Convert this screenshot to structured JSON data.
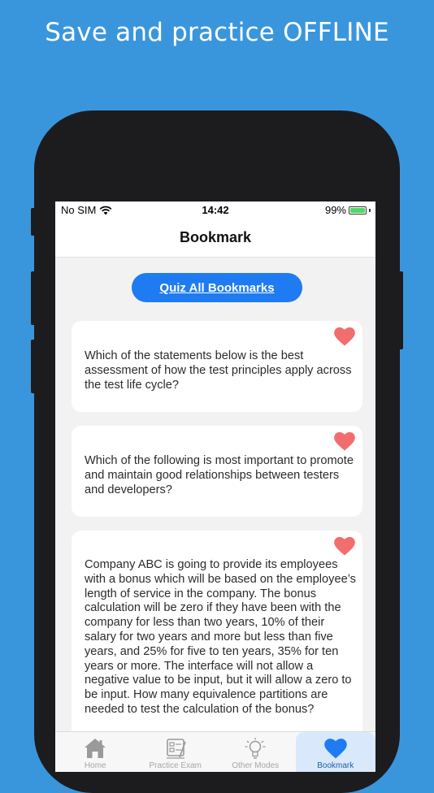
{
  "headline": "Save and practice OFFLINE",
  "status": {
    "carrier": "No SIM",
    "time": "14:42",
    "battery": "99%"
  },
  "nav": {
    "title": "Bookmark"
  },
  "quiz_button": "Quiz All Bookmarks",
  "cards": [
    {
      "text": "Which of the statements below is the best assessment of how the test principles apply across the test life cycle?"
    },
    {
      "text": "Which of the following is most important to promote and maintain good relationships between testers and developers?"
    },
    {
      "text": "Company ABC is going to provide its employees with a bonus which will be based on the employee’s length of service in the company. The bonus calculation will be zero if they have been with the company for less than two years, 10% of their salary for two years and more but less than five years, and 25% for five to ten years, 35% for ten years or more. The interface will not allow a negative value to be input, but it will allow a zero to be input. How many equivalence partitions are needed to test the calculation of the bonus?"
    }
  ],
  "tabs": [
    {
      "label": "Home",
      "icon": "home-icon"
    },
    {
      "label": "Practice Exam",
      "icon": "exam-icon"
    },
    {
      "label": "Other Modes",
      "icon": "lightbulb-icon"
    },
    {
      "label": "Bookmark",
      "icon": "heart-icon"
    }
  ],
  "colors": {
    "background": "#3a96dc",
    "accent": "#1f7bf2",
    "heart": "#f26d6d"
  }
}
